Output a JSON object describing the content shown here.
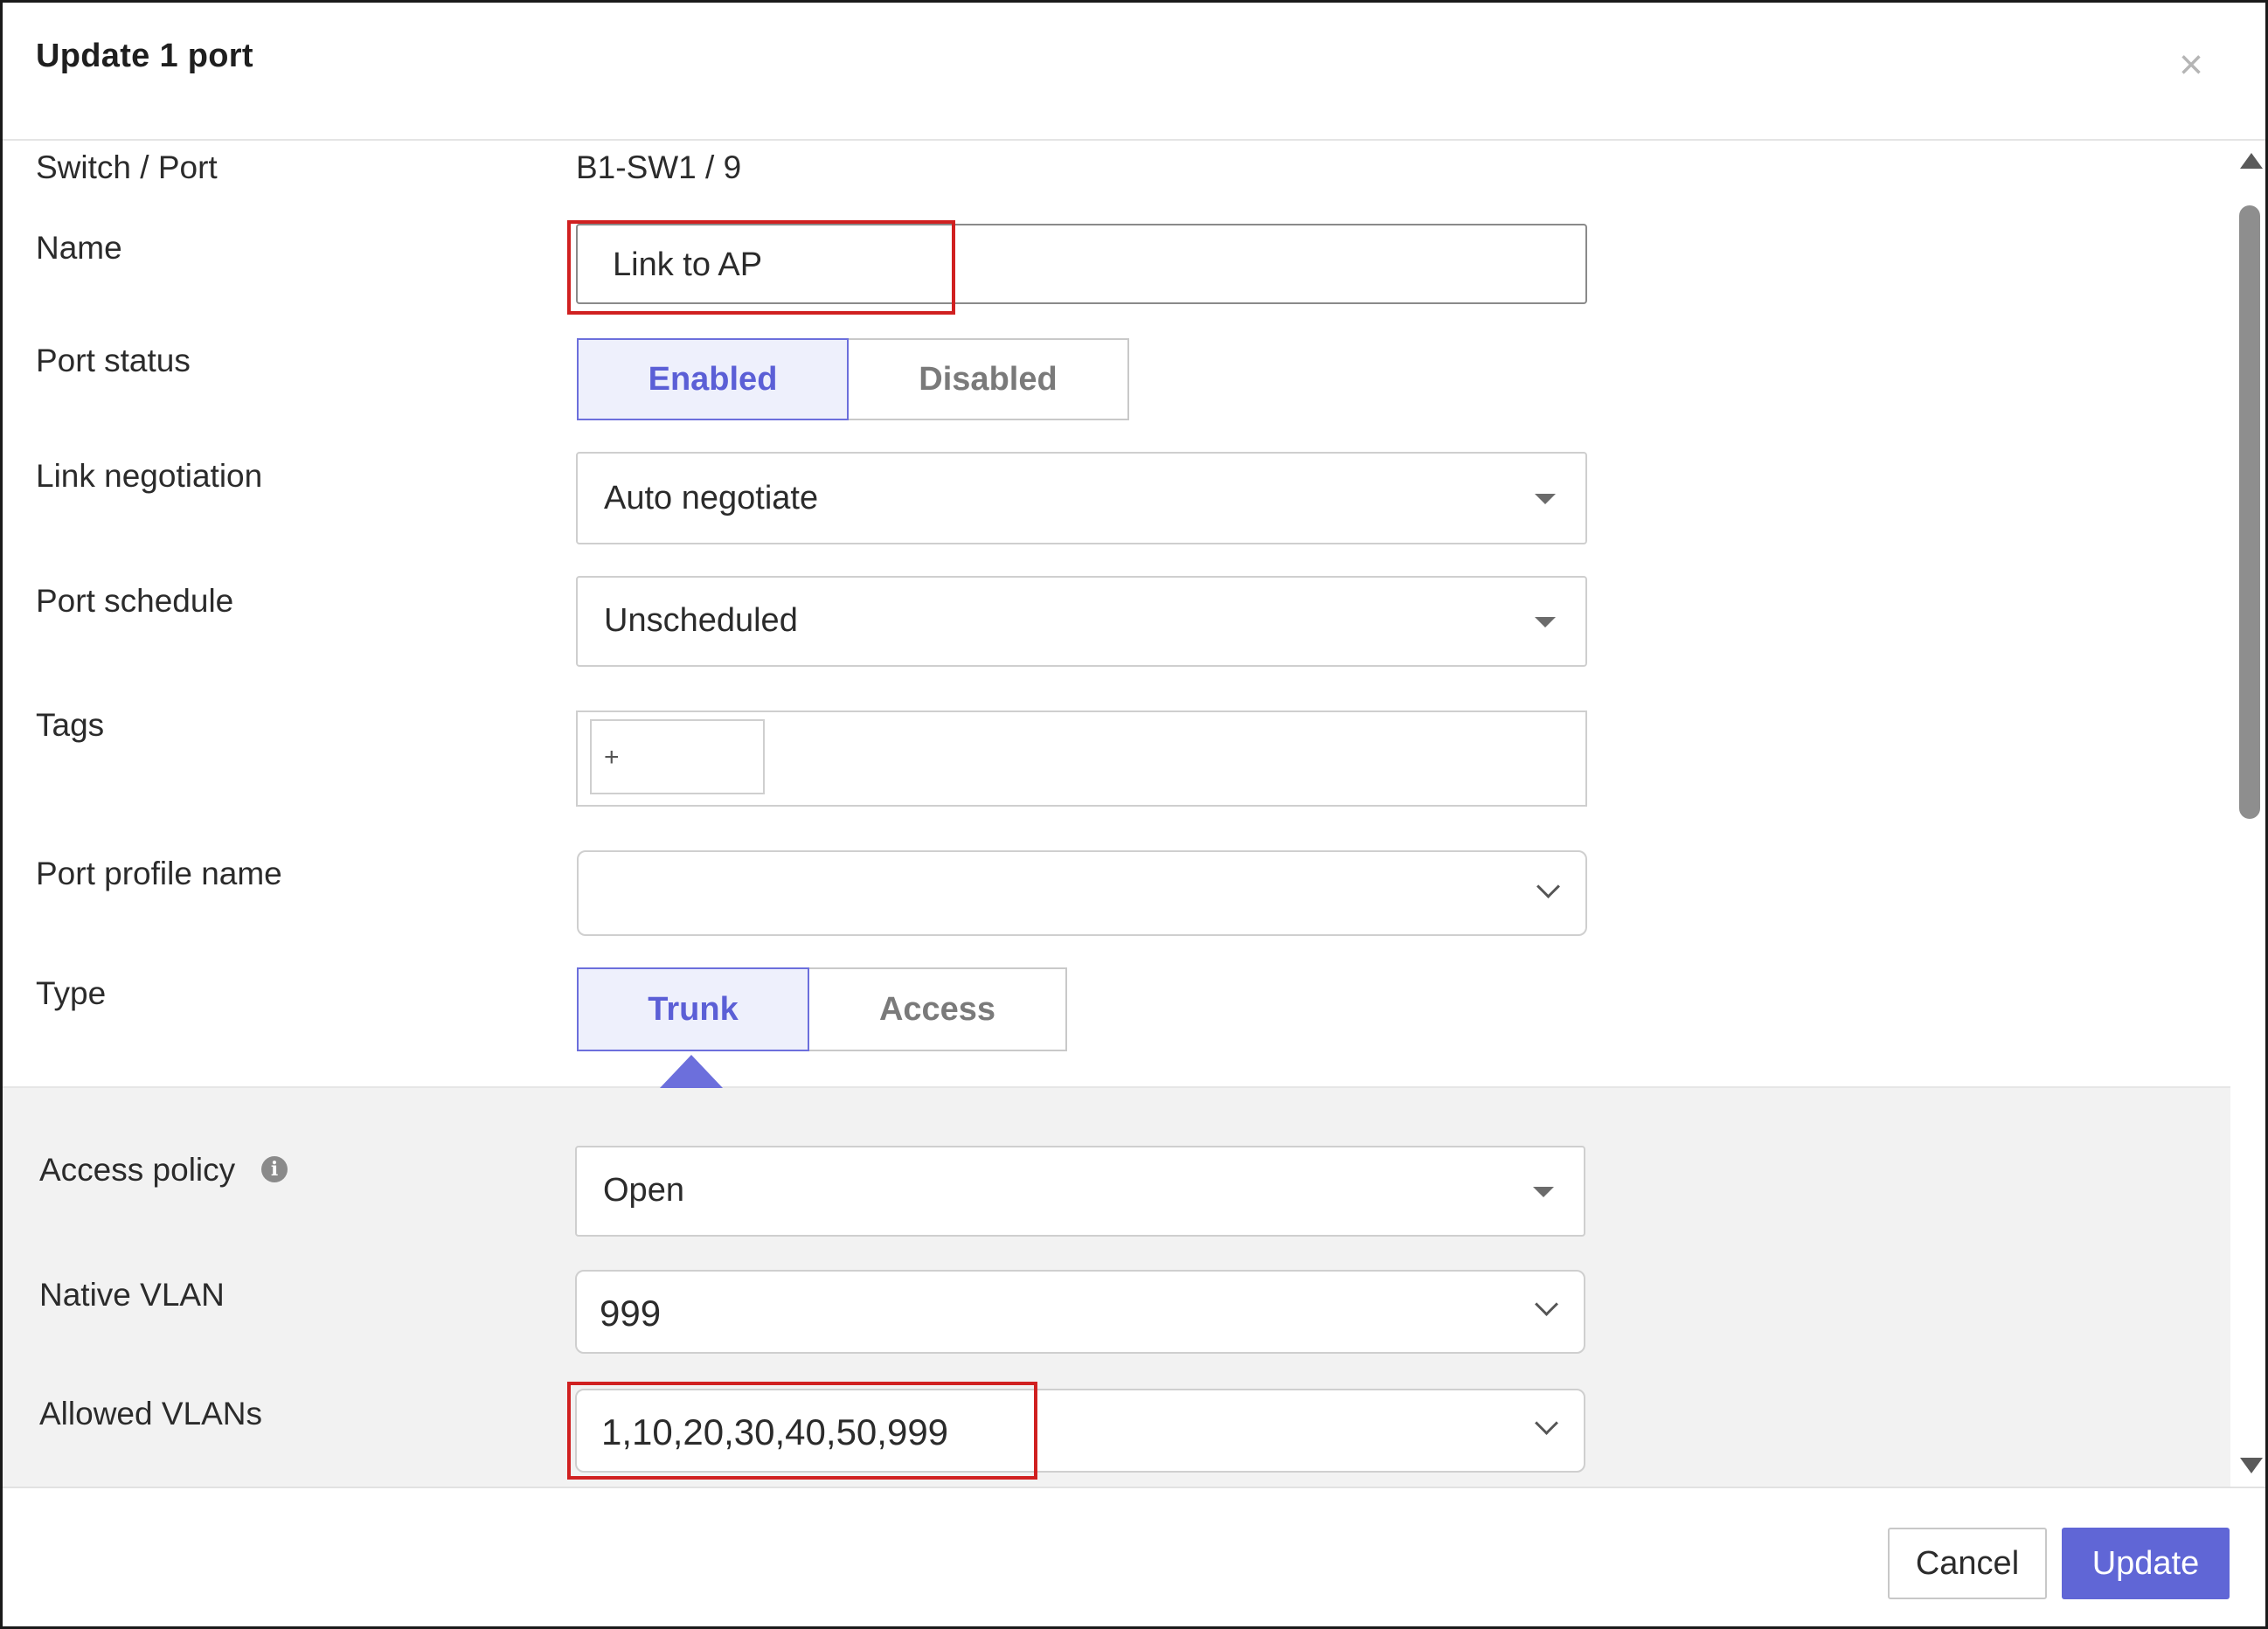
{
  "dialog": {
    "title": "Update 1 port",
    "close_icon": "close-icon"
  },
  "fields": {
    "switch_port": {
      "label": "Switch / Port",
      "value": "B1-SW1 / 9"
    },
    "name": {
      "label": "Name",
      "value": "Link to AP"
    },
    "port_status": {
      "label": "Port status",
      "options": [
        "Enabled",
        "Disabled"
      ],
      "selected": "Enabled"
    },
    "link_negotiation": {
      "label": "Link negotiation",
      "value": "Auto negotiate"
    },
    "port_schedule": {
      "label": "Port schedule",
      "value": "Unscheduled"
    },
    "tags": {
      "label": "Tags",
      "add_symbol": "+"
    },
    "port_profile_name": {
      "label": "Port profile name",
      "value": ""
    },
    "type": {
      "label": "Type",
      "options": [
        "Trunk",
        "Access"
      ],
      "selected": "Trunk"
    },
    "access_policy": {
      "label": "Access policy",
      "value": "Open",
      "info_icon": "info-icon",
      "info_glyph": "i"
    },
    "native_vlan": {
      "label": "Native VLAN",
      "value": "999"
    },
    "allowed_vlans": {
      "label": "Allowed VLANs",
      "value": "1,10,20,30,40,50,999"
    }
  },
  "footer": {
    "cancel_label": "Cancel",
    "update_label": "Update"
  },
  "colors": {
    "accent": "#6066d6",
    "segment_active_bg": "#eef0fc",
    "highlight_red": "#d02020",
    "panel_grey": "#f2f2f2"
  }
}
